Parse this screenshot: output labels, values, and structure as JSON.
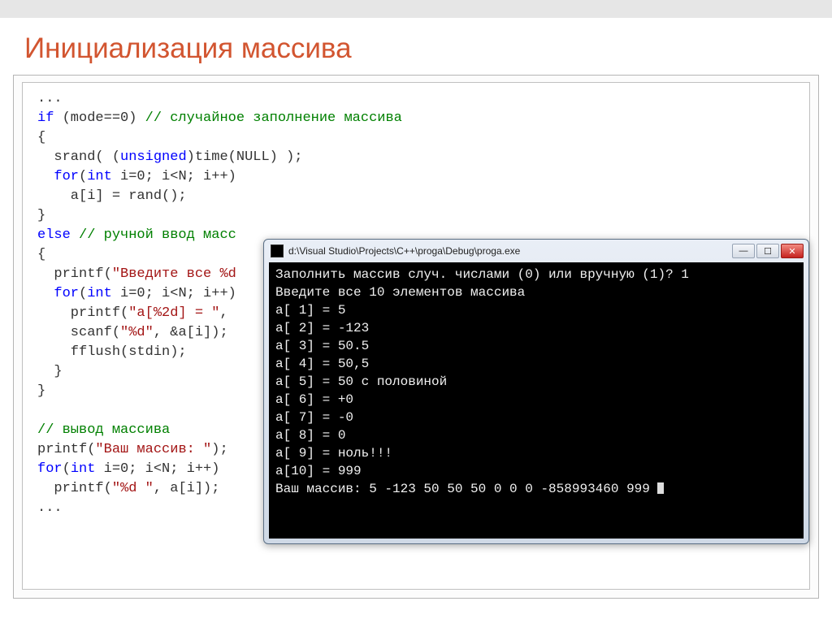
{
  "title": "Инициализация массива",
  "code": {
    "l01": "...",
    "l02_kw": "if",
    "l02_plain": " (mode==0) ",
    "l02_cm": "// случайное заполнение массива",
    "l03": "{",
    "l04_pre": "  srand( (",
    "l04_kw": "unsigned",
    "l04_post": ")time(NULL) );",
    "l05_pre": "  ",
    "l05_kw": "for",
    "l05_mid": "(",
    "l05_kw2": "int",
    "l05_post": " i=0; i<N; i++)",
    "l06": "    a[i] = rand();",
    "l07": "}",
    "l08_kw": "else",
    "l08_sp": " ",
    "l08_cm": "// ручной ввод масс",
    "l09": "{",
    "l10_pre": "  printf(",
    "l10_str": "\"Введите все %d",
    "l11_pre": "  ",
    "l11_kw": "for",
    "l11_mid": "(",
    "l11_kw2": "int",
    "l11_post": " i=0; i<N; i++)",
    "l12_pre": "    printf(",
    "l12_str": "\"a[%2d] = \"",
    "l12_post": ",",
    "l13_pre": "    scanf(",
    "l13_str": "\"%d\"",
    "l13_post": ", &a[i]);",
    "l14": "    fflush(stdin);",
    "l15": "  }",
    "l16": "}",
    "blank": "",
    "l17_cm": "// вывод массива",
    "l18_pre": "printf(",
    "l18_str": "\"Ваш массив: \"",
    "l18_post": ");",
    "l19_kw": "for",
    "l19_mid": "(",
    "l19_kw2": "int",
    "l19_post": " i=0; i<N; i++)",
    "l20_pre": "  printf(",
    "l20_str": "\"%d \"",
    "l20_post": ", a[i]);",
    "l21": "..."
  },
  "console": {
    "path": "d:\\Visual Studio\\Projects\\C++\\proga\\Debug\\proga.exe",
    "lines": [
      "Заполнить массив случ. числами (0) или вручную (1)? 1",
      "Введите все 10 элементов массива",
      "a[ 1] = 5",
      "a[ 2] = -123",
      "a[ 3] = 50.5",
      "a[ 4] = 50,5",
      "a[ 5] = 50 с половиной",
      "a[ 6] = +0",
      "a[ 7] = -0",
      "a[ 8] = 0",
      "a[ 9] = ноль!!!",
      "a[10] = 999",
      "Ваш массив: 5 -123 50 50 50 0 0 0 -858993460 999 "
    ]
  },
  "buttons": {
    "min": "—",
    "max": "☐",
    "close": "✕"
  }
}
